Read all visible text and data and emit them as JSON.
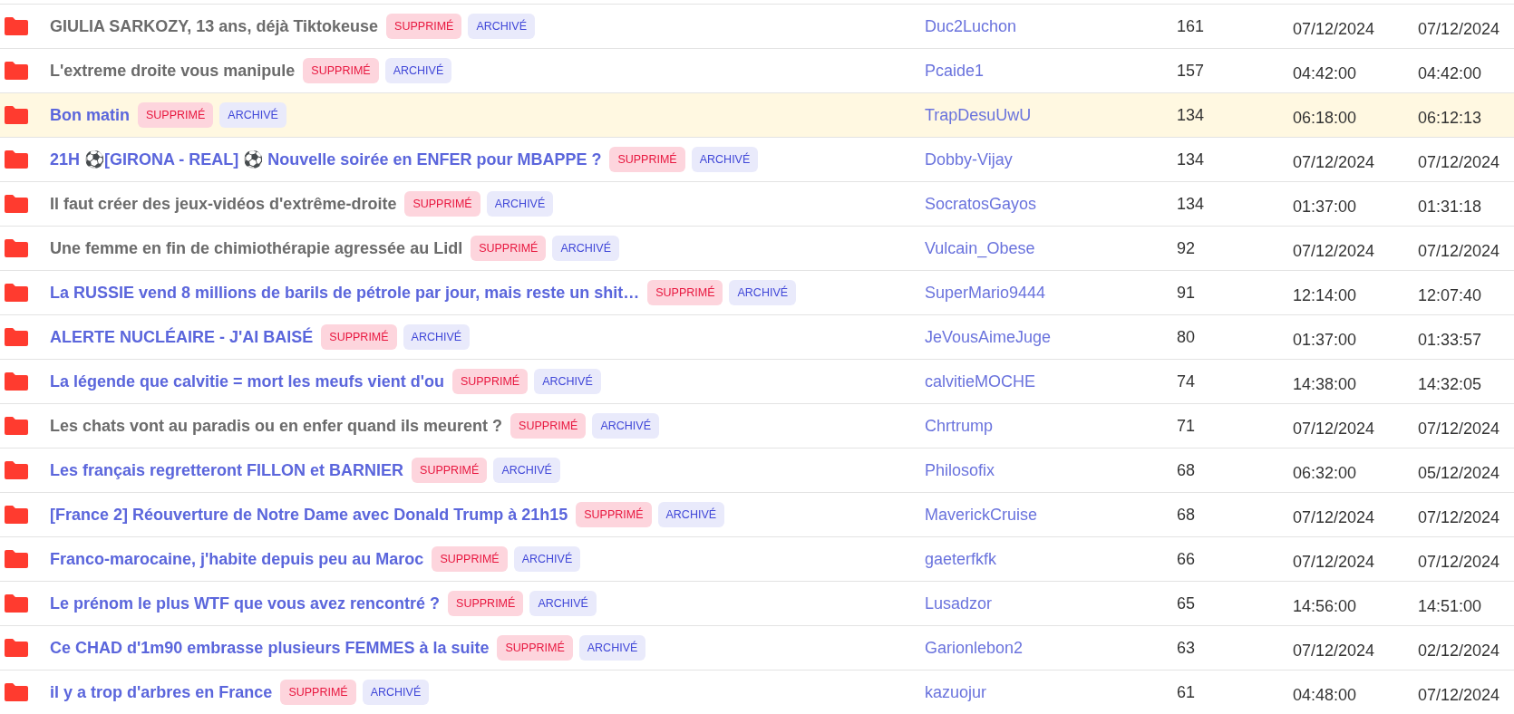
{
  "topics": [
    {
      "title": "GIULIA SARKOZY, 13 ans, déjà Tiktokeuse",
      "visited": true,
      "highlighted": false,
      "badges": [
        {
          "label": "SUPPRIMÉ",
          "kind": "deleted"
        },
        {
          "label": "ARCHIVÉ",
          "kind": "archived"
        }
      ],
      "author": "Duc2Luchon",
      "replies": "161",
      "created": "07/12/2024",
      "last_post": "07/12/2024"
    },
    {
      "title": "L'extreme droite vous manipule",
      "visited": true,
      "highlighted": false,
      "badges": [
        {
          "label": "SUPPRIMÉ",
          "kind": "deleted"
        },
        {
          "label": "ARCHIVÉ",
          "kind": "archived"
        }
      ],
      "author": "Pcaide1",
      "replies": "157",
      "created": "04:42:00",
      "last_post": "04:42:00"
    },
    {
      "title": "Bon matin",
      "visited": false,
      "highlighted": true,
      "badges": [
        {
          "label": "SUPPRIMÉ",
          "kind": "deleted"
        },
        {
          "label": "ARCHIVÉ",
          "kind": "archived"
        }
      ],
      "author": "TrapDesuUwU",
      "replies": "134",
      "created": "06:18:00",
      "last_post": "06:12:13"
    },
    {
      "title": "21H ⚽[GIRONA - REAL] ⚽ Nouvelle soirée en ENFER pour MBAPPE ?",
      "visited": false,
      "highlighted": false,
      "badges": [
        {
          "label": "SUPPRIMÉ",
          "kind": "deleted"
        },
        {
          "label": "ARCHIVÉ",
          "kind": "archived"
        }
      ],
      "author": "Dobby-Vijay",
      "replies": "134",
      "created": "07/12/2024",
      "last_post": "07/12/2024"
    },
    {
      "title": "Il faut créer des jeux-vidéos d'extrême-droite",
      "visited": true,
      "highlighted": false,
      "badges": [
        {
          "label": "SUPPRIMÉ",
          "kind": "deleted"
        },
        {
          "label": "ARCHIVÉ",
          "kind": "archived"
        }
      ],
      "author": "SocratosGayos",
      "replies": "134",
      "created": "01:37:00",
      "last_post": "01:31:18"
    },
    {
      "title": "Une femme en fin de chimiothérapie agressée au Lidl",
      "visited": true,
      "highlighted": false,
      "badges": [
        {
          "label": "SUPPRIMÉ",
          "kind": "deleted"
        },
        {
          "label": "ARCHIVÉ",
          "kind": "archived"
        }
      ],
      "author": "Vulcain_Obese",
      "replies": "92",
      "created": "07/12/2024",
      "last_post": "07/12/2024"
    },
    {
      "title": "La RUSSIE vend 8 millions de barils de pétrole par jour, mais reste un shit…",
      "visited": false,
      "highlighted": false,
      "badges": [
        {
          "label": "SUPPRIMÉ",
          "kind": "deleted"
        },
        {
          "label": "ARCHIVÉ",
          "kind": "archived"
        }
      ],
      "author": "SuperMario9444",
      "replies": "91",
      "created": "12:14:00",
      "last_post": "12:07:40"
    },
    {
      "title": "ALERTE NUCLÉAIRE - J'AI BAISÉ",
      "visited": false,
      "highlighted": false,
      "badges": [
        {
          "label": "SUPPRIMÉ",
          "kind": "deleted"
        },
        {
          "label": "ARCHIVÉ",
          "kind": "archived"
        }
      ],
      "author": "JeVousAimeJuge",
      "replies": "80",
      "created": "01:37:00",
      "last_post": "01:33:57"
    },
    {
      "title": "La légende que calvitie = mort les meufs vient d'ou",
      "visited": false,
      "highlighted": false,
      "badges": [
        {
          "label": "SUPPRIMÉ",
          "kind": "deleted"
        },
        {
          "label": "ARCHIVÉ",
          "kind": "archived"
        }
      ],
      "author": "calvitieMOCHE",
      "replies": "74",
      "created": "14:38:00",
      "last_post": "14:32:05"
    },
    {
      "title": "Les chats vont au paradis ou en enfer quand ils meurent ?",
      "visited": true,
      "highlighted": false,
      "badges": [
        {
          "label": "SUPPRIMÉ",
          "kind": "deleted"
        },
        {
          "label": "ARCHIVÉ",
          "kind": "archived"
        }
      ],
      "author": "Chrtrump",
      "replies": "71",
      "created": "07/12/2024",
      "last_post": "07/12/2024"
    },
    {
      "title": "Les français regretteront FILLON et BARNIER",
      "visited": false,
      "highlighted": false,
      "badges": [
        {
          "label": "SUPPRIMÉ",
          "kind": "deleted"
        },
        {
          "label": "ARCHIVÉ",
          "kind": "archived"
        }
      ],
      "author": "Philosofix",
      "replies": "68",
      "created": "06:32:00",
      "last_post": "05/12/2024"
    },
    {
      "title": "[France 2] Réouverture de Notre Dame avec Donald Trump à 21h15",
      "visited": false,
      "highlighted": false,
      "badges": [
        {
          "label": "SUPPRIMÉ",
          "kind": "deleted"
        },
        {
          "label": "ARCHIVÉ",
          "kind": "archived"
        }
      ],
      "author": "MaverickCruise",
      "replies": "68",
      "created": "07/12/2024",
      "last_post": "07/12/2024"
    },
    {
      "title": "Franco-marocaine, j'habite depuis peu au Maroc",
      "visited": false,
      "highlighted": false,
      "badges": [
        {
          "label": "SUPPRIMÉ",
          "kind": "deleted"
        },
        {
          "label": "ARCHIVÉ",
          "kind": "archived"
        }
      ],
      "author": "gaeterfkfk",
      "replies": "66",
      "created": "07/12/2024",
      "last_post": "07/12/2024"
    },
    {
      "title": "Le prénom le plus WTF que vous avez rencontré ?",
      "visited": false,
      "highlighted": false,
      "badges": [
        {
          "label": "SUPPRIMÉ",
          "kind": "deleted"
        },
        {
          "label": "ARCHIVÉ",
          "kind": "archived"
        }
      ],
      "author": "Lusadzor",
      "replies": "65",
      "created": "14:56:00",
      "last_post": "14:51:00"
    },
    {
      "title": "Ce CHAD d'1m90 embrasse plusieurs FEMMES à la suite",
      "visited": false,
      "highlighted": false,
      "badges": [
        {
          "label": "SUPPRIMÉ",
          "kind": "deleted"
        },
        {
          "label": "ARCHIVÉ",
          "kind": "archived"
        }
      ],
      "author": "Garionlebon2",
      "replies": "63",
      "created": "07/12/2024",
      "last_post": "02/12/2024"
    },
    {
      "title": "il y a trop d'arbres en France",
      "visited": false,
      "highlighted": false,
      "badges": [
        {
          "label": "SUPPRIMÉ",
          "kind": "deleted"
        },
        {
          "label": "ARCHIVÉ",
          "kind": "archived"
        }
      ],
      "author": "kazuojur",
      "replies": "61",
      "created": "04:48:00",
      "last_post": "07/12/2024"
    }
  ]
}
